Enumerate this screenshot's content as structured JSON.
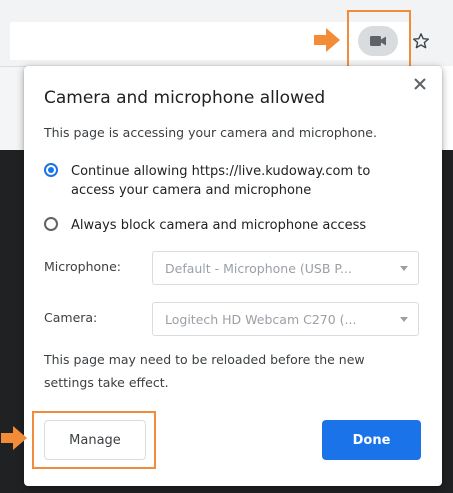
{
  "browser": {
    "camera_indicator_icon": "video-camera-icon",
    "bookmark_icon": "star-icon",
    "highlight_color": "#f28c38"
  },
  "popup": {
    "title": "Camera and microphone allowed",
    "subtitle": "This page is accessing your camera and microphone.",
    "options": [
      {
        "label": "Continue allowing https://live.kudoway.com to access your camera and microphone",
        "selected": true
      },
      {
        "label": "Always block camera and microphone access",
        "selected": false
      }
    ],
    "microphone": {
      "label": "Microphone:",
      "value": "Default - Microphone (USB P..."
    },
    "camera": {
      "label": "Camera:",
      "value": "Logitech HD Webcam C270 (..."
    },
    "note": "This page may need to be reloaded before the new settings take effect.",
    "manage_label": "Manage",
    "done_label": "Done",
    "accent_color": "#1a73e8"
  }
}
